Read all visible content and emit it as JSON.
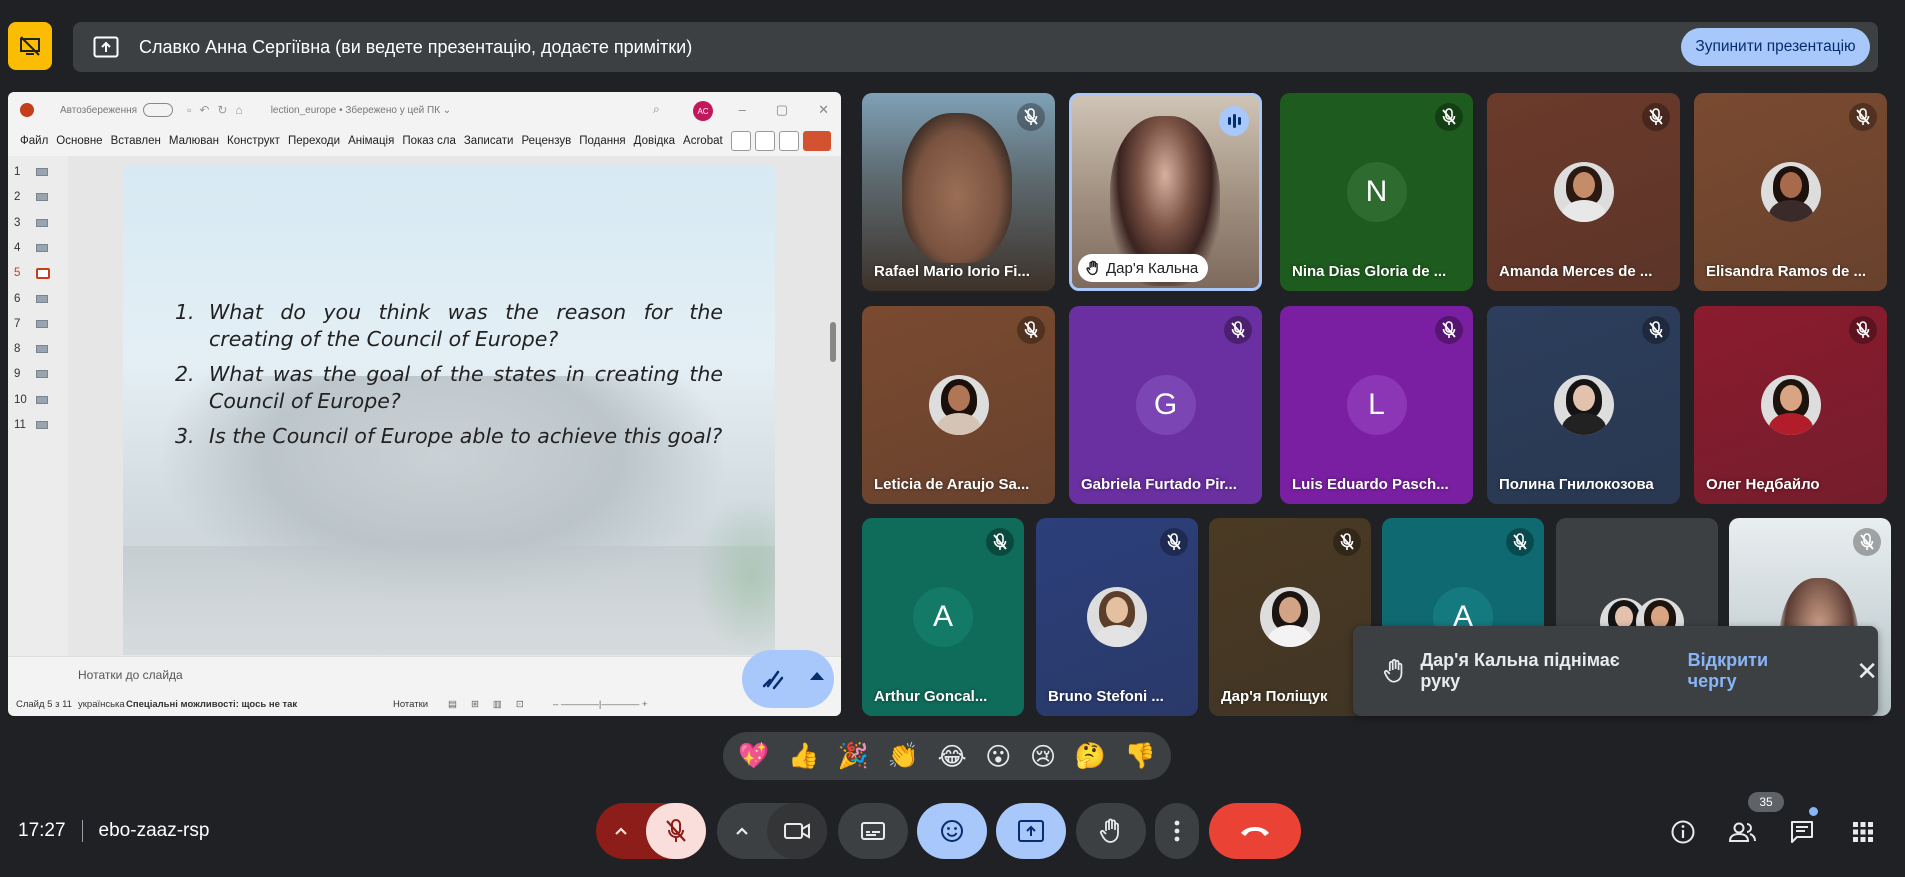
{
  "banner": {
    "text": "Славко Анна Сергіївна (ви ведете презентацію, додаєте примітки)",
    "stop_label": "Зупинити презентацію"
  },
  "ppt": {
    "autosave_label": "Автозбереження",
    "filename": "lection_europe • Збережено у цей ПК ⌄",
    "avatar_initials": "AC",
    "ribbon_tabs": [
      "Файл",
      "Основне",
      "Вставлен",
      "Малюван",
      "Конструкт",
      "Переходи",
      "Анімація",
      "Показ сла",
      "Записати",
      "Рецензув",
      "Подання",
      "Довідка",
      "Acrobat"
    ],
    "slide_numbers": [
      "1",
      "2",
      "3",
      "4",
      "5",
      "6",
      "7",
      "8",
      "9",
      "10",
      "11"
    ],
    "active_slide_index": 5,
    "questions": [
      {
        "num": "1.",
        "text": "What do you think was the reason for the creating of the Council of Europe?"
      },
      {
        "num": "2.",
        "text": "What was the goal of the states in creating the Council of Europe?"
      },
      {
        "num": "3.",
        "text": "Is the Council of Europe able to achieve this goal?"
      }
    ],
    "notes_label": "Нотатки до слайда",
    "status": {
      "slide_counter": "Слайд 5 з 11",
      "language": "українська",
      "accessibility": "Спеціальні можливості: щось не так",
      "notes_btn": "Нотатки"
    }
  },
  "participants": [
    {
      "name": "Rafael Mario Iorio Fi...",
      "type": "video"
    },
    {
      "name": "Дар'я Кальна",
      "type": "video-speaking",
      "hand_raised": true
    },
    {
      "name": "Nina Dias Gloria de ...",
      "type": "letter",
      "letter": "N",
      "bg": "#1e5b1e",
      "circle": "#2e6b2e"
    },
    {
      "name": "Amanda Merces de ...",
      "type": "avatar",
      "bg": "#6b3a2a"
    },
    {
      "name": "Elisandra Ramos de ...",
      "type": "avatar",
      "bg": "#7a4a30"
    },
    {
      "name": "Leticia de Araujo Sa...",
      "type": "avatar",
      "bg": "#7a4a30"
    },
    {
      "name": "Gabriela Furtado Pir...",
      "type": "letter",
      "letter": "G",
      "bg": "#6a2fa0",
      "circle": "#7b45b3"
    },
    {
      "name": "Luis Eduardo Pasch...",
      "type": "letter",
      "letter": "L",
      "bg": "#7a1fa2",
      "circle": "#8c35b5"
    },
    {
      "name": "Полина Гнилокозова",
      "type": "avatar",
      "bg": "#2c3e5c"
    },
    {
      "name": "Олег Недбайло",
      "type": "avatar",
      "bg": "#8a1c2e"
    },
    {
      "name": "Arthur Goncal...",
      "type": "letter",
      "letter": "A",
      "bg": "#0f6b5a",
      "circle": "#137a67"
    },
    {
      "name": "Bruno Stefoni ...",
      "type": "avatar",
      "bg": "#2c3f7a"
    },
    {
      "name": "Дар'я Поліщук",
      "type": "avatar",
      "bg": "#4a3a24"
    },
    {
      "name": "",
      "type": "letter",
      "letter": "A",
      "bg": "#0e6a70",
      "circle": "#147a80"
    },
    {
      "name": "",
      "type": "group",
      "bg": "#3c4043"
    },
    {
      "name": "",
      "type": "video"
    }
  ],
  "toast": {
    "text": "Дар'я Кальна піднімає руку",
    "link": "Відкрити чергу",
    "close": "✕"
  },
  "reactions": [
    "💖",
    "👍",
    "🎉",
    "👏",
    "😂",
    "😮",
    "😢",
    "🤔",
    "👎"
  ],
  "meeting": {
    "time": "17:27",
    "code": "ebo-zaaz-rsp",
    "participant_count": "35"
  },
  "colors": {
    "bg": "#202124",
    "accent_blue": "#a8c7fa",
    "leave_red": "#ea4335",
    "mic_off_red": "#f9dedc",
    "banner_yellow": "#fbbc04"
  }
}
